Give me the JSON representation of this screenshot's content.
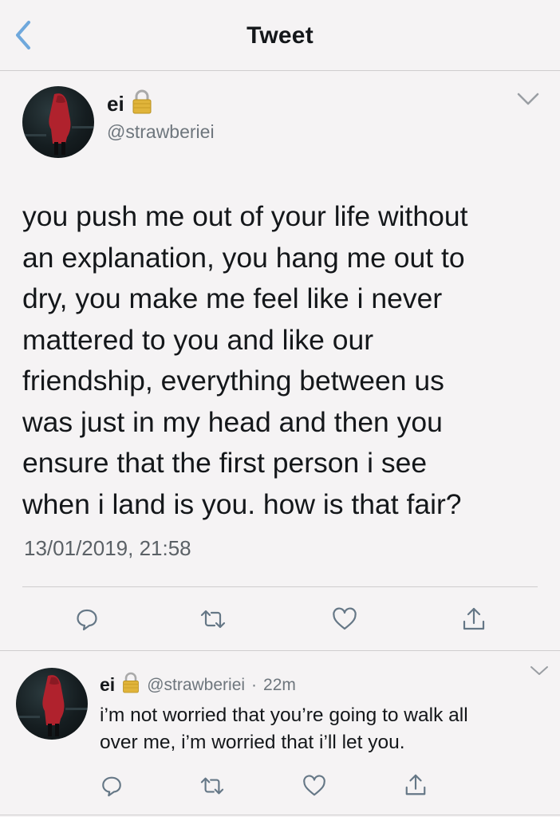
{
  "nav": {
    "title": "Tweet",
    "back_icon": "chevron-left-icon"
  },
  "main_tweet": {
    "author_name": "ei",
    "author_handle": "@strawberiei",
    "lock_icon": "lock-icon",
    "text": "you push me out of your life without\nan explanation, you hang me out to\ndry, you make me feel like i never\nmattered to you and like our\nfriendship, everything between us\nwas just in my head and then you\nensure that the first person i see\nwhen i land is you. how is that fair?",
    "timestamp": "13/01/2019, 21:58",
    "actions": [
      "reply-icon",
      "retweet-icon",
      "like-icon",
      "share-icon"
    ]
  },
  "reply_tweet": {
    "author_name": "ei",
    "author_handle": "@strawberiei",
    "separator": "·",
    "time_ago": "22m",
    "text": "i’m not worried that you’re going to walk all\nover me, i’m worried that i’ll let you.",
    "actions": [
      "reply-icon",
      "retweet-icon",
      "like-icon",
      "share-icon"
    ]
  },
  "colors": {
    "background": "#f5f3f4",
    "accent": "#1da1f2",
    "icon_gray": "#657786",
    "text": "#14171a"
  }
}
